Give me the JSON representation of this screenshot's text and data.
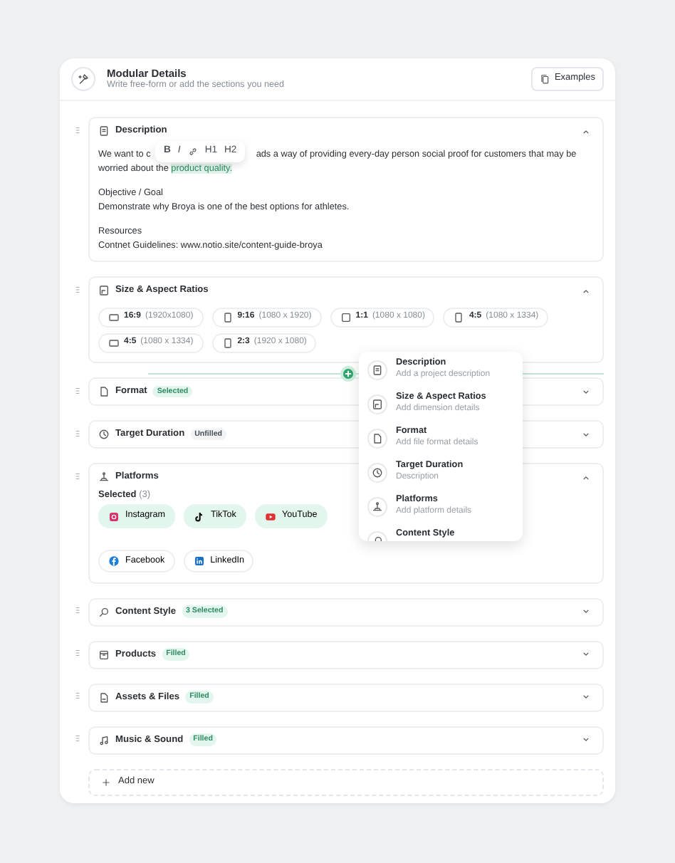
{
  "header": {
    "title": "Modular Details",
    "subtitle": "Write free-form or add the sections you need",
    "button": "Examples"
  },
  "toolbar": [
    "B",
    "I",
    "H1",
    "H2"
  ],
  "sections": [
    {
      "kind": "description",
      "title": "Description",
      "expanded": true,
      "intro": {
        "before": "We want to c",
        "after": "ads a way of providing every-day person social proof for customers that may be worried about the ",
        "highlight": "product quality."
      },
      "blocks": [
        {
          "heading": "Objective / Goal",
          "text": "Demonstrate why Broya is one of the best options for athletes."
        },
        {
          "heading": "Resources",
          "text": "Contnet Guidelines: www.notio.site/content-guide-broya"
        }
      ]
    },
    {
      "kind": "size",
      "title": "Size & Aspect Ratios",
      "expanded": true,
      "ratios": [
        {
          "kind": "landscape",
          "ratio": "16:9",
          "dims": "(1920x1080)"
        },
        {
          "kind": "portrait",
          "ratio": "9:16",
          "dims": "(1080 x 1920)"
        },
        {
          "kind": "square",
          "ratio": "1:1",
          "dims": "(1080 x 1080)"
        },
        {
          "kind": "portrait",
          "ratio": "4:5",
          "dims": "(1080 x 1334)"
        },
        {
          "kind": "landscape",
          "ratio": "4:5",
          "dims": "(1080 x 1334)"
        },
        {
          "kind": "portrait",
          "ratio": "2:3",
          "dims": "(1920 x 1080)"
        }
      ]
    },
    {
      "kind": "format",
      "title": "Format",
      "expanded": false,
      "badge": {
        "text": "Selected",
        "kind": "positive"
      }
    },
    {
      "kind": "duration",
      "title": "Target Duration",
      "expanded": false,
      "badge": {
        "text": "Unfilled",
        "kind": "neutral"
      }
    },
    {
      "kind": "platforms",
      "title": "Platforms",
      "expanded": true,
      "selected_label": "Selected",
      "selected_count": "(3)",
      "platforms": [
        {
          "kind": "instagram",
          "label": "Instagram",
          "selected": true
        },
        {
          "kind": "tiktok",
          "label": "TikTok",
          "selected": true
        },
        {
          "kind": "youtube",
          "label": "YouTube",
          "selected": true
        },
        {
          "kind": "facebook",
          "label": "Facebook",
          "selected": false
        },
        {
          "kind": "linkedin",
          "label": "LinkedIn",
          "selected": false
        }
      ]
    },
    {
      "kind": "style",
      "title": "Content Style",
      "expanded": false,
      "badge": {
        "text": "3 Selected",
        "kind": "positive"
      }
    },
    {
      "kind": "products",
      "title": "Products",
      "expanded": false,
      "badge": {
        "text": "Filled",
        "kind": "positive"
      }
    },
    {
      "kind": "assets",
      "title": "Assets & Files",
      "expanded": false,
      "badge": {
        "text": "Filled",
        "kind": "positive"
      }
    },
    {
      "kind": "music",
      "title": "Music & Sound",
      "expanded": false,
      "badge": {
        "text": "Filled",
        "kind": "positive"
      }
    }
  ],
  "add_new": "Add new",
  "menu": [
    {
      "kind": "description",
      "title": "Description",
      "description": "Add a project description"
    },
    {
      "kind": "size",
      "title": "Size & Aspect Ratios",
      "description": "Add dimension details"
    },
    {
      "kind": "format",
      "title": "Format",
      "description": "Add file format details"
    },
    {
      "kind": "duration",
      "title": "Target Duration",
      "description": "Description"
    },
    {
      "kind": "platforms",
      "title": "Platforms",
      "description": "Add platform details"
    },
    {
      "kind": "style",
      "title": "Content Style"
    }
  ]
}
